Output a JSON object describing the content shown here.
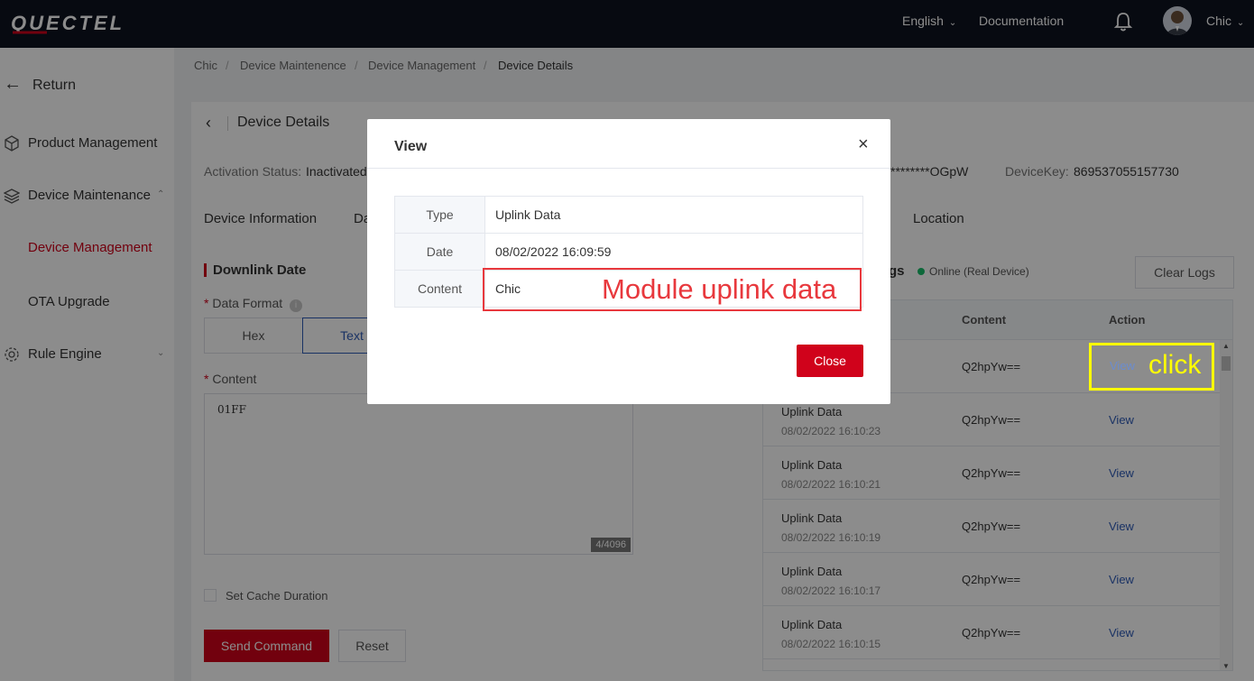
{
  "topbar": {
    "brand": "QUECTEL",
    "language": "English",
    "documentation": "Documentation",
    "user": "Chic"
  },
  "sidebar": {
    "return_label": "Return",
    "items": [
      {
        "label": "Product Management"
      },
      {
        "label": "Device Maintenance"
      },
      {
        "label": "Device Management"
      },
      {
        "label": "OTA Upgrade"
      },
      {
        "label": "Rule Engine"
      }
    ]
  },
  "breadcrumb": {
    "items": [
      "Chic",
      "Device Maintenence",
      "Device Management",
      "Device Details"
    ],
    "separator": "/"
  },
  "page": {
    "title": "Device Details",
    "activation_label": "Activation Status:",
    "activation_value": "Inactivated",
    "secret_partial": "********OGpW",
    "devicekey_label": "DeviceKey:",
    "devicekey_value": "869537055157730",
    "tabs": [
      "Device Information",
      "Da",
      "Location"
    ]
  },
  "downlink": {
    "heading": "Downlink Date",
    "format_label": "Data Format",
    "format_options": [
      "Hex",
      "Text"
    ],
    "format_selected": "Text",
    "content_label": "Content",
    "content_value": "01FF",
    "counter": "4/4096",
    "cache_label": "Set Cache Duration",
    "send_label": "Send Command",
    "reset_label": "Reset"
  },
  "logs": {
    "heading_partial": "gs",
    "status": "Online (Real Device)",
    "clear_label": "Clear Logs",
    "col_content": "Content",
    "col_action": "Action",
    "rows": [
      {
        "type": "",
        "time": "",
        "content": "Q2hpYw==",
        "action": "View"
      },
      {
        "type": "Uplink Data",
        "time": "08/02/2022 16:10:23",
        "content": "Q2hpYw==",
        "action": "View"
      },
      {
        "type": "Uplink Data",
        "time": "08/02/2022 16:10:21",
        "content": "Q2hpYw==",
        "action": "View"
      },
      {
        "type": "Uplink Data",
        "time": "08/02/2022 16:10:19",
        "content": "Q2hpYw==",
        "action": "View"
      },
      {
        "type": "Uplink Data",
        "time": "08/02/2022 16:10:17",
        "content": "Q2hpYw==",
        "action": "View"
      },
      {
        "type": "Uplink Data",
        "time": "08/02/2022 16:10:15",
        "content": "Q2hpYw==",
        "action": "View"
      }
    ]
  },
  "modal": {
    "title": "View",
    "rows": [
      {
        "key": "Type",
        "value": "Uplink Data"
      },
      {
        "key": "Date",
        "value": "08/02/2022 16:09:59"
      },
      {
        "key": "Content",
        "value": "Chic"
      }
    ],
    "close_label": "Close"
  },
  "annotations": {
    "module_note": "Module uplink data",
    "click_note": "click"
  },
  "colors": {
    "accent_red": "#d0021b",
    "link_blue": "#2f5bb7",
    "annotation_red": "#e8383d",
    "annotation_yellow": "#ffff00",
    "nav_bg": "#0d1320"
  }
}
